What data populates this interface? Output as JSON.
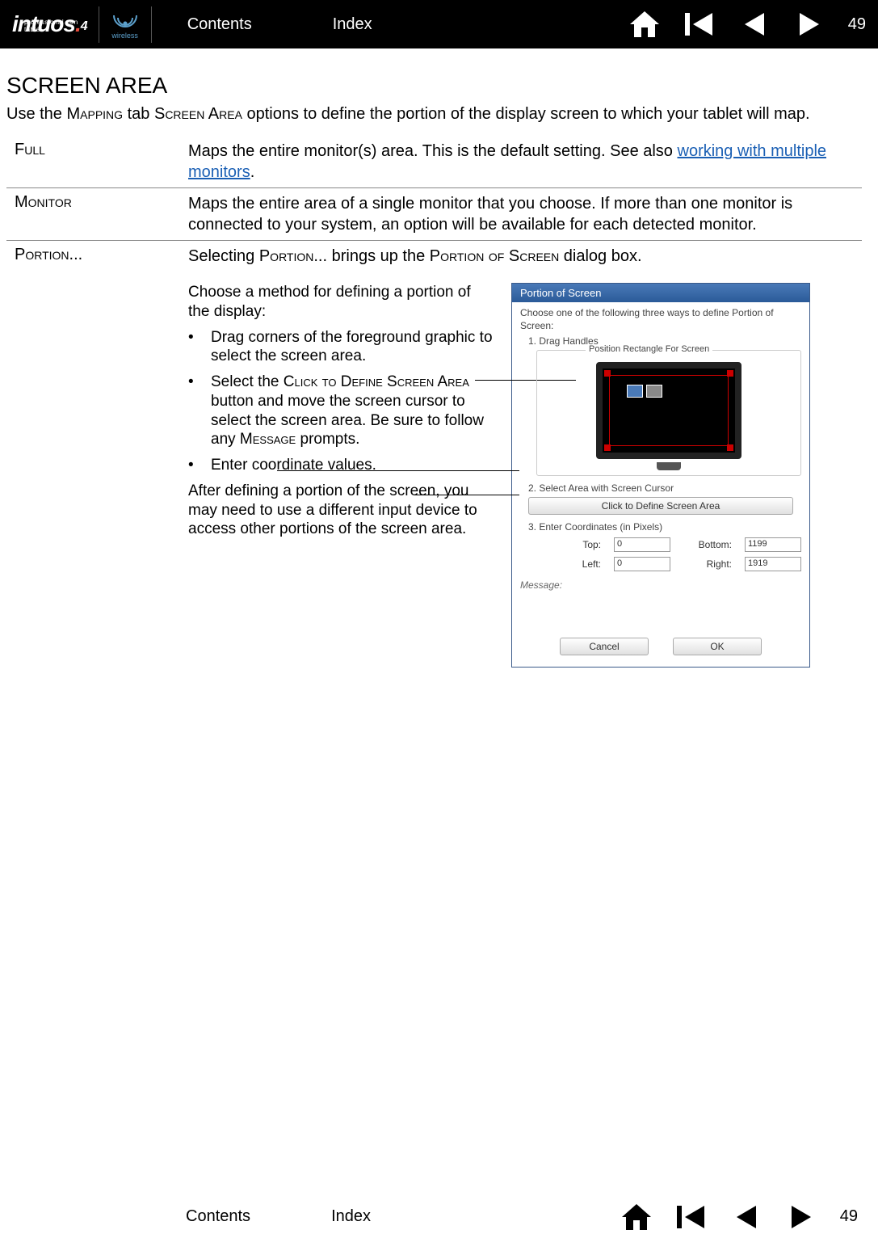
{
  "header": {
    "logo_main": "intuos",
    "logo_suffix": "4",
    "logo_tagline": "professional pen tablet",
    "wireless_label": "wireless",
    "contents_link": "Contents",
    "index_link": "Index",
    "page_number": "49"
  },
  "content": {
    "title": "SCREEN AREA",
    "intro_pre": "Use the ",
    "intro_sc1": "Mapping",
    "intro_mid1": " tab ",
    "intro_sc2": "Screen Area",
    "intro_post": " options to define the portion of the display screen to which your tablet will map.",
    "rows": {
      "full": {
        "label": "Full",
        "desc_pre": "Maps the entire monitor(s) area.  This is the default setting.  See also ",
        "desc_link": "working with multiple monitors",
        "desc_post": "."
      },
      "monitor": {
        "label": "Monitor",
        "desc": "Maps the entire area of a single monitor that you choose.  If more than one monitor is connected to your system, an option will be available for each detected monitor."
      },
      "portion": {
        "label": "Portion...",
        "desc_pre": "Selecting ",
        "desc_sc1": "Portion",
        "desc_mid1": "... brings up the ",
        "desc_sc2": "Portion of Screen",
        "desc_post": " dialog box."
      }
    },
    "portion_text": {
      "intro": "Choose a method for defining a portion of the display:",
      "bullet1": "Drag corners of the foreground graphic to select the screen area.",
      "bullet2_pre": "Select the ",
      "bullet2_sc1": "Click to Define Screen Area",
      "bullet2_mid": " button and move the screen cursor to select the screen area.  Be sure to follow any ",
      "bullet2_sc2": "Message",
      "bullet2_post": " prompts.",
      "bullet3": "Enter coordinate values.",
      "after": "After defining a portion of the screen, you may need to use a different input device to access other portions of the screen area."
    }
  },
  "dialog": {
    "title": "Portion of Screen",
    "intro": "Choose one of the following three ways to define Portion of Screen:",
    "section1": "1. Drag Handles",
    "rect_title": "Position Rectangle For Screen",
    "section2": "2. Select Area with Screen Cursor",
    "define_button": "Click to Define Screen Area",
    "section3": "3. Enter Coordinates (in Pixels)",
    "coords": {
      "top_label": "Top:",
      "top_value": "0",
      "bottom_label": "Bottom:",
      "bottom_value": "1199",
      "left_label": "Left:",
      "left_value": "0",
      "right_label": "Right:",
      "right_value": "1919"
    },
    "message_label": "Message:",
    "cancel": "Cancel",
    "ok": "OK"
  },
  "footer": {
    "contents_link": "Contents",
    "index_link": "Index",
    "page_number": "49"
  }
}
